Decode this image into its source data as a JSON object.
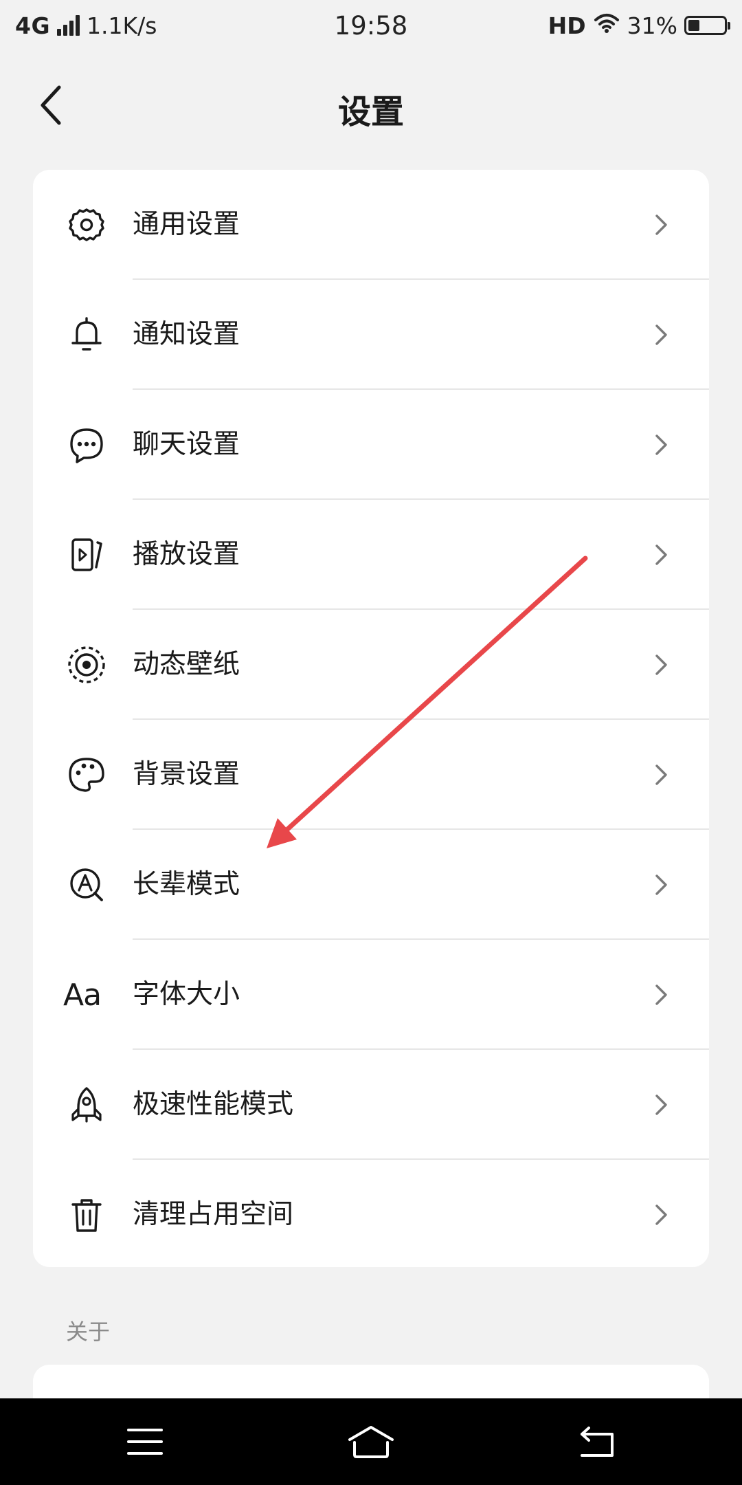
{
  "status_bar": {
    "network": "4G",
    "speed": "1.1K/s",
    "time": "19:58",
    "hd": "HD",
    "battery": "31%",
    "battery_level": 0.31
  },
  "header": {
    "title": "设置",
    "back_icon": "chevron-left-icon"
  },
  "settings": {
    "items": [
      {
        "label": "通用设置",
        "icon": "gear-icon"
      },
      {
        "label": "通知设置",
        "icon": "bell-icon"
      },
      {
        "label": "聊天设置",
        "icon": "chat-bubble-icon"
      },
      {
        "label": "播放设置",
        "icon": "play-icon"
      },
      {
        "label": "动态壁纸",
        "icon": "live-wallpaper-icon"
      },
      {
        "label": "背景设置",
        "icon": "palette-icon"
      },
      {
        "label": "长辈模式",
        "icon": "elder-mode-icon"
      },
      {
        "label": "字体大小",
        "icon": "font-size-icon",
        "icon_text": "Aa"
      },
      {
        "label": "极速性能模式",
        "icon": "rocket-icon"
      },
      {
        "label": "清理占用空间",
        "icon": "trash-icon"
      }
    ]
  },
  "about": {
    "section_label": "关于"
  },
  "nav_bar": {
    "menu_icon": "menu-icon",
    "home_icon": "home-icon",
    "back_icon": "back-return-icon"
  },
  "annotation": {
    "color": "#e8474a"
  },
  "colors": {
    "background": "#f2f2f2",
    "card": "#ffffff",
    "text": "#1a1a1a",
    "chevron": "#7a7a7a",
    "divider": "#e6e6e6"
  }
}
